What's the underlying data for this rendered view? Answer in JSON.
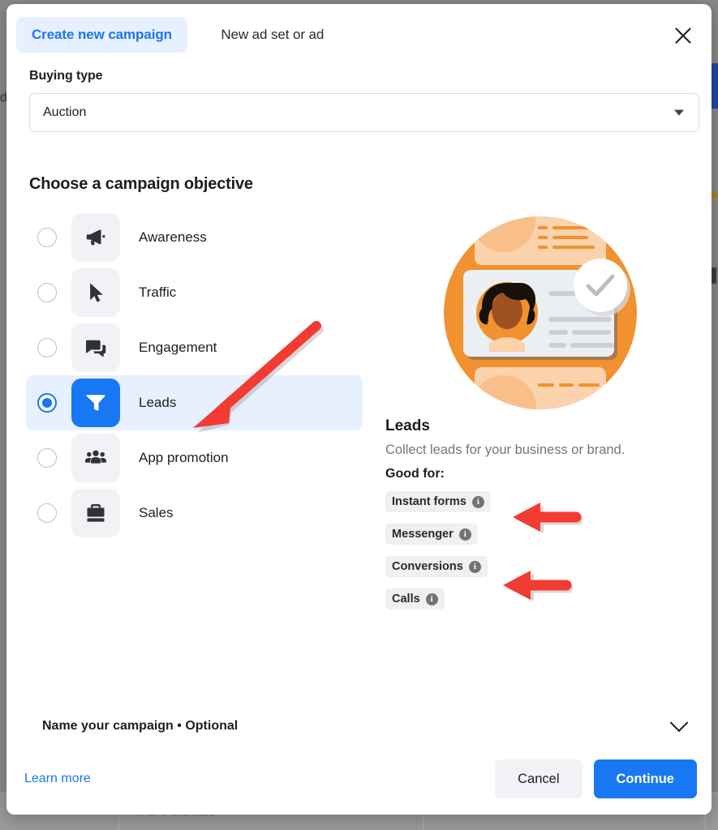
{
  "background": {
    "table_cell_text": "Per Purchase",
    "left_glyph": "d"
  },
  "dialog": {
    "tabs": [
      {
        "label": "Create new campaign",
        "active": true
      },
      {
        "label": "New ad set or ad",
        "active": false
      }
    ],
    "close_icon": "close-icon",
    "buying_type": {
      "label": "Buying type",
      "value": "Auction"
    },
    "objective_section": {
      "title": "Choose a campaign objective",
      "options": [
        {
          "label": "Awareness",
          "icon": "megaphone-icon",
          "selected": false
        },
        {
          "label": "Traffic",
          "icon": "cursor-icon",
          "selected": false
        },
        {
          "label": "Engagement",
          "icon": "chat-bubble-icon",
          "selected": false
        },
        {
          "label": "Leads",
          "icon": "funnel-icon",
          "selected": true
        },
        {
          "label": "App promotion",
          "icon": "people-icon",
          "selected": false
        },
        {
          "label": "Sales",
          "icon": "briefcase-icon",
          "selected": false
        }
      ]
    },
    "detail": {
      "illustration": "leads-profile-card-illustration",
      "title": "Leads",
      "description": "Collect leads for your business or brand.",
      "good_for_label": "Good for:",
      "good_for": [
        {
          "label": "Instant forms",
          "info": "i"
        },
        {
          "label": "Messenger",
          "info": "i"
        },
        {
          "label": "Conversions",
          "info": "i"
        },
        {
          "label": "Calls",
          "info": "i"
        }
      ]
    },
    "name_campaign": {
      "label": "Name your campaign • Optional",
      "chevron": "chevron-down-icon"
    },
    "footer": {
      "learn_more": "Learn more",
      "cancel": "Cancel",
      "continue": "Continue"
    }
  },
  "annotations": [
    {
      "name": "arrow-to-leads-option",
      "direction": "down-left"
    },
    {
      "name": "arrow-to-instant-forms",
      "direction": "left"
    },
    {
      "name": "arrow-to-conversions",
      "direction": "left"
    }
  ],
  "colors": {
    "accent_blue": "#1877f2",
    "tab_active_bg": "#e7f0fe",
    "selected_row_bg": "#e7f0fe",
    "icon_tile_bg": "#f0f2f5",
    "chip_bg": "#f0f0f0",
    "annotation_red": "#f23b33",
    "illustration_orange": "#f1912f"
  }
}
